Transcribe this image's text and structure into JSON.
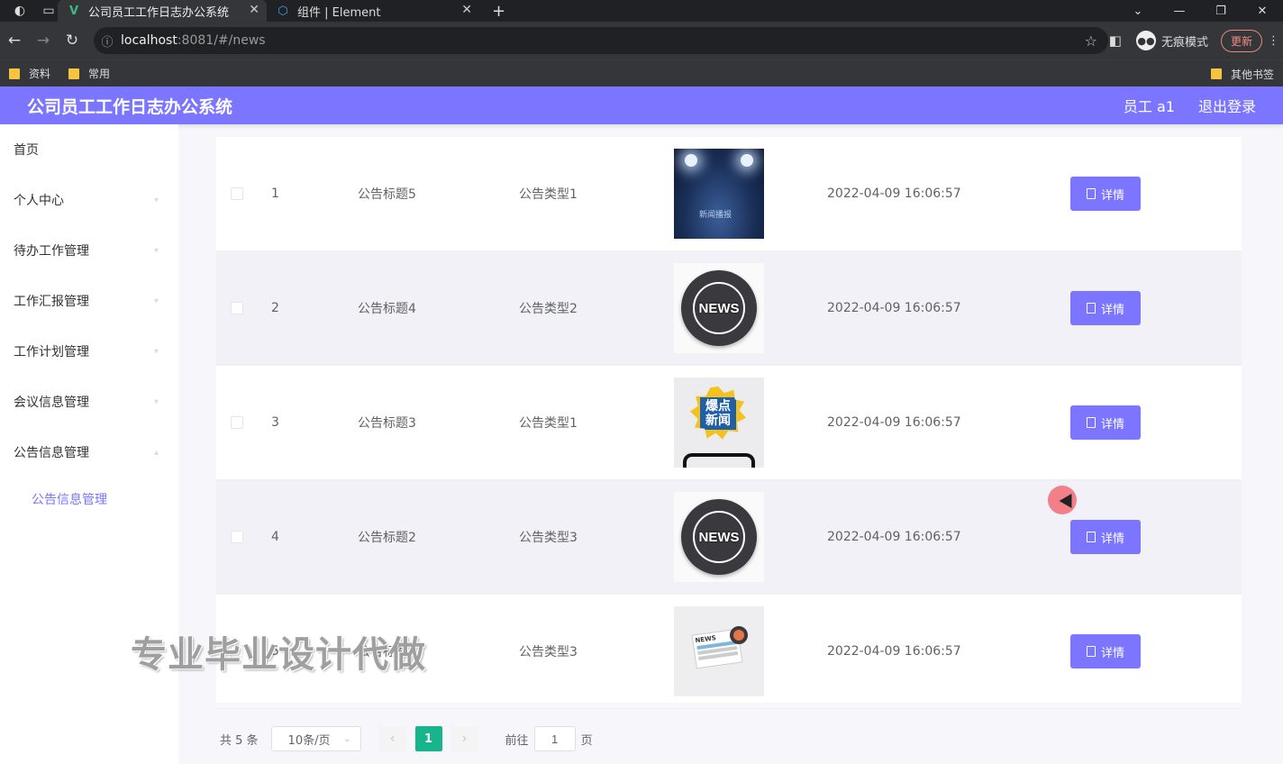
{
  "browser": {
    "tabs": [
      {
        "label": "公司员工工作日志办公系统",
        "icon": "vue-logo-icon"
      },
      {
        "label": "组件 | Element",
        "icon": "element-logo-icon"
      }
    ],
    "url_host": "localhost",
    "url_path": ":8081/#/news",
    "incognito_label": "无痕模式",
    "update_label": "更新",
    "bookmarks": [
      "资料",
      "常用"
    ],
    "other_bookmarks": "其他书签"
  },
  "app": {
    "title": "公司员工工作日志办公系统",
    "user": "员工 a1",
    "logout": "退出登录"
  },
  "sidebar": {
    "items": [
      "首页",
      "个人中心",
      "待办工作管理",
      "工作汇报管理",
      "工作计划管理",
      "会议信息管理",
      "公告信息管理"
    ],
    "sub_item": "公告信息管理"
  },
  "table": {
    "rows": [
      {
        "index": "1",
        "title": "公告标题5",
        "type": "公告类型1",
        "time": "2022-04-09 16:06:57",
        "image": "stage-spotlight-image"
      },
      {
        "index": "2",
        "title": "公告标题4",
        "type": "公告类型2",
        "time": "2022-04-09 16:06:57",
        "image": "news-globe-image"
      },
      {
        "index": "3",
        "title": "公告标题3",
        "type": "公告类型1",
        "time": "2022-04-09 16:06:57",
        "image": "hot-news-image"
      },
      {
        "index": "4",
        "title": "公告标题2",
        "type": "公告类型3",
        "time": "2022-04-09 16:06:57",
        "image": "news-globe-image"
      },
      {
        "index": "5",
        "title": "公告标题1",
        "type": "公告类型3",
        "time": "2022-04-09 16:06:57",
        "image": "newspaper-image"
      }
    ],
    "detail_label": "详情",
    "stage_caption": "新闻播报",
    "news_text": "NEWS",
    "hot_text": "爆点新闻",
    "paper_text": "NEWS"
  },
  "pagination": {
    "total": "共 5 条",
    "page_size": "10条/页",
    "current": "1",
    "goto_prefix": "前往",
    "goto_value": "1",
    "goto_suffix": "页"
  },
  "watermark": "专业毕业设计代做",
  "colors": {
    "accent": "#7b75ff",
    "pager_active": "#18b58c"
  }
}
